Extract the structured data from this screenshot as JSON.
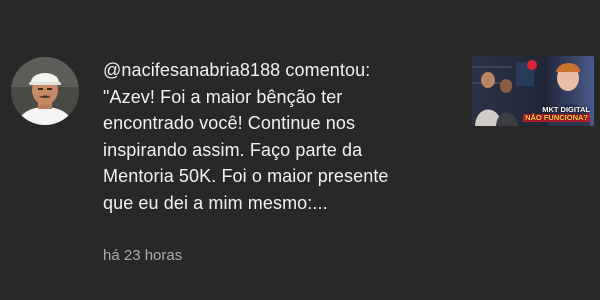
{
  "notification": {
    "message_lines": [
      "@nacifesanabria8188 comentou:",
      "\"Azev! Foi a maior bênção ter",
      "encontrado você! Continue nos",
      "inspirando assim. Faço parte da",
      "Mentoria 50K. Foi o maior presente",
      "que eu dei a mim mesmo:..."
    ],
    "timestamp": "há 23 horas",
    "thumbnail": {
      "title_line1": "MKT DIGITAL",
      "title_line2": "NÃO FUNCIONA?"
    }
  },
  "colors": {
    "background": "#282828",
    "primary_text": "#f1f1f1",
    "secondary_text": "#aaaaaa"
  }
}
